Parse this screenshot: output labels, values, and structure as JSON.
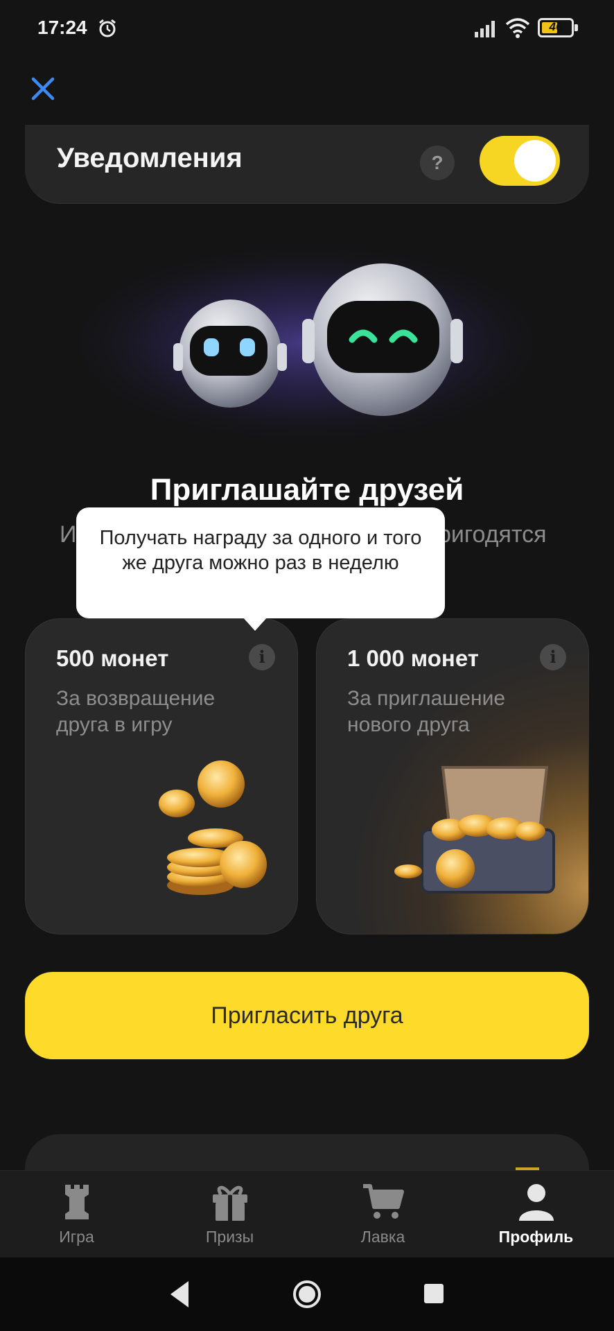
{
  "status_bar": {
    "time": "17:24",
    "battery": "46",
    "icons": [
      "alarm-icon",
      "signal-icon",
      "wifi-icon",
      "battery-icon"
    ]
  },
  "header": {
    "close_icon": "close-icon"
  },
  "notifications": {
    "title": "Уведомления",
    "help_label": "?",
    "toggle_on": true
  },
  "invite": {
    "title": "Приглашайте друзей",
    "subtitle_left": "И",
    "subtitle_right": "ригодятся",
    "tooltip": "Получать награду за одного и того же друга можно раз в неделю",
    "button_label": "Пригласить друга"
  },
  "rewards": [
    {
      "amount": "500 монет",
      "description": "За возвращение друга в игру",
      "info_label": "i"
    },
    {
      "amount": "1 000 монет",
      "description": "За приглашение нового друга",
      "info_label": "i"
    }
  ],
  "bottom_nav": [
    {
      "label": "Игра",
      "icon": "chess-rook-icon",
      "active": false
    },
    {
      "label": "Призы",
      "icon": "gift-icon",
      "active": false
    },
    {
      "label": "Лавка",
      "icon": "cart-icon",
      "active": false
    },
    {
      "label": "Профиль",
      "icon": "profile-icon",
      "active": true
    }
  ],
  "colors": {
    "background": "#141414",
    "card": "#292929",
    "accent_yellow": "#fedb2b",
    "muted_text": "#8c8c8c"
  }
}
